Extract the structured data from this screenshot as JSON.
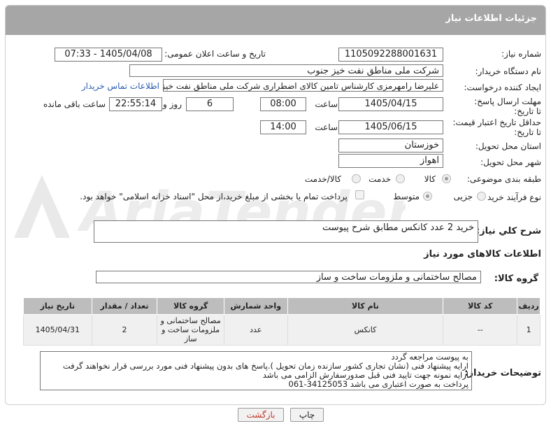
{
  "header": {
    "title": "جزئیات اطلاعات نیاز"
  },
  "watermark": {
    "text": "AriaTender.net"
  },
  "fields": {
    "need_number_label": "شماره نیاز:",
    "need_number": "1105092288001631",
    "announce_label": "تاریخ و ساعت اعلان عمومی:",
    "announce_value": "1405/04/08 - 07:33",
    "buyer_org_label": "نام دستگاه خریدار:",
    "buyer_org": "شرکت ملی مناطق نفت خیز جنوب",
    "creator_label": "ایجاد کننده درخواست:",
    "creator": "علیرضا رامهرمزی کارشناس تامین کالای اضطراری شرکت ملی مناطق نفت خیز جنوب",
    "contact_link": "اطلاعات تماس خریدار",
    "reply_deadline_label": "مهلت ارسال پاسخ: تا تاریخ:",
    "reply_date": "1405/04/15",
    "time_label": "ساعت",
    "reply_time": "08:00",
    "days": "6",
    "days_label": "روز و",
    "remaining_time": "22:55:14",
    "remaining_label": "ساعت باقی مانده",
    "price_validity_label": "حداقل تاریخ اعتبار قیمت: تا تاریخ:",
    "price_date": "1405/06/15",
    "price_time": "14:00",
    "province_label": "استان محل تحویل:",
    "province": "خوزستان",
    "city_label": "شهر محل تحویل:",
    "city": "اهواز",
    "category_label": "طبقه بندی موضوعی:",
    "category_options": [
      "کالا",
      "خدمت",
      "کالا/خدمت"
    ],
    "process_label": "نوع فرآیند خرید :",
    "process_options": [
      "جزیی",
      "متوسط"
    ],
    "payment_note": "پرداخت تمام یا بخشی از مبلغ خرید،از محل \"اسناد خزانه اسلامی\" خواهد بود.",
    "desc_label": "شرح کلي نياز:",
    "description": "خرید 2 عدد کانکس مطابق شرح پیوست",
    "goods_info_heading": "اطلاعات کالاهای مورد نیاز",
    "goods_group_label": "گروه کالا:",
    "goods_group": "مصالح ساختمانی و ملزومات ساخت و ساز"
  },
  "table": {
    "headers": [
      "ردیف",
      "کد کالا",
      "نام کالا",
      "واحد شمارش",
      "گروه کالا",
      "تعداد / مقدار",
      "تاریخ نیاز"
    ],
    "rows": [
      [
        "1",
        "--",
        "کانکس",
        "عدد",
        "مصالح ساختمانی و ملزومات ساخت و ساز",
        "2",
        "1405/04/31"
      ]
    ]
  },
  "buyer_notes": {
    "label": "توضیحات خریدار:",
    "lines": [
      "به پیوست مراجعه گردد",
      "ارایه پیشنهاد فنی (نشان تجاری کشور سازنده زمان تحویل ).پاسخ های بدون پیشنهاد فنی مورد بررسی قرار نخواهند گرفت",
      "ارایه نمونه جهت تایید فنی قبل صدورسفارش الزامی می باشد",
      "پرداخت به صورت اعتباری می باشد 34125053-061"
    ]
  },
  "buttons": {
    "print": "چاپ",
    "back": "بازگشت"
  },
  "colors": {
    "header_bg": "#a6a6a6",
    "table_header_bg": "#bdbdbd",
    "link": "#2a5db0",
    "back_text": "#c0392b"
  }
}
